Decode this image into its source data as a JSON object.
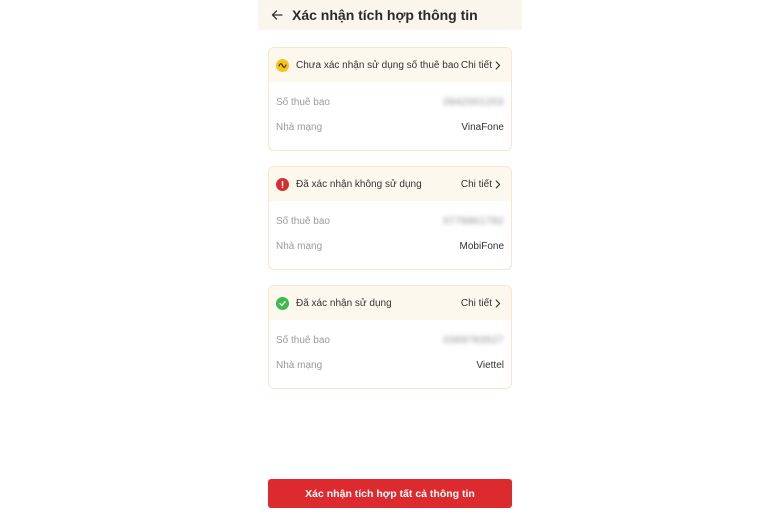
{
  "header": {
    "title": "Xác nhận tích hợp thông tin",
    "back_icon": "arrow-left-icon"
  },
  "cards": [
    {
      "status": "Chưa xác nhận sử dụng số thuê bao",
      "status_icon": "pending-wave-icon",
      "status_color": "#f5c518",
      "detail_label": "Chi tiết",
      "subscriber_label": "Số thuê bao",
      "subscriber_value": "0942001203",
      "carrier_label": "Nhà mạng",
      "carrier_value": "VinaFone"
    },
    {
      "status": "Đã xác nhận không sử dụng",
      "status_icon": "error-exclamation-icon",
      "status_color": "#d32f2f",
      "detail_label": "Chi tiết",
      "subscriber_label": "Số thuê bao",
      "subscriber_value": "0778861782",
      "carrier_label": "Nhà mạng",
      "carrier_value": "MobiFone"
    },
    {
      "status": "Đã xác nhận sử dụng",
      "status_icon": "check-circle-icon",
      "status_color": "#3fb950",
      "detail_label": "Chi tiết",
      "subscriber_label": "Số thuê bao",
      "subscriber_value": "0369783527",
      "carrier_label": "Nhà mạng",
      "carrier_value": "Viettel"
    }
  ],
  "footer": {
    "confirm_all_label": "Xác nhận tích hợp tất cả thông tin",
    "button_color": "#dc2a2e"
  }
}
